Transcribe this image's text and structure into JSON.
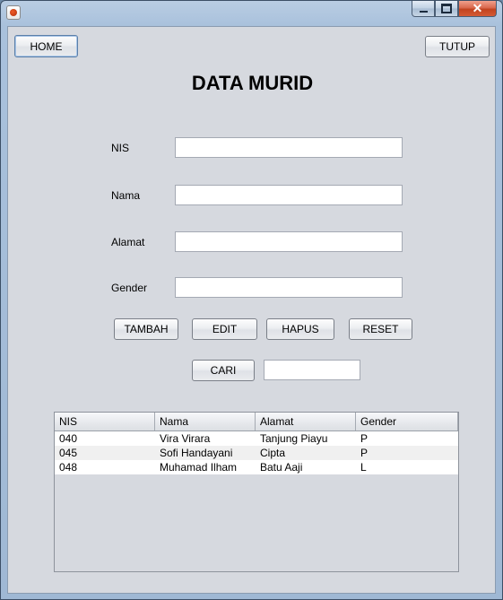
{
  "window": {
    "title": "",
    "caption_buttons": {
      "minimize": "minimize-icon",
      "maximize": "maximize-icon",
      "close": "close-icon"
    }
  },
  "toolbar": {
    "home_label": "HOME",
    "close_label": "TUTUP"
  },
  "page_title": "DATA MURID",
  "form": {
    "nis_label": "NIS",
    "nis_value": "",
    "nama_label": "Nama",
    "nama_value": "",
    "alamat_label": "Alamat",
    "alamat_value": "",
    "gender_label": "Gender",
    "gender_value": ""
  },
  "actions": {
    "add_label": "TAMBAH",
    "edit_label": "EDIT",
    "delete_label": "HAPUS",
    "reset_label": "RESET"
  },
  "search": {
    "button_label": "CARI",
    "value": ""
  },
  "table": {
    "columns": [
      "NIS",
      "Nama",
      "Alamat",
      "Gender"
    ],
    "rows": [
      [
        "040",
        "Vira Virara",
        "Tanjung Piayu",
        "P"
      ],
      [
        "045",
        "Sofi Handayani",
        "Cipta",
        "P"
      ],
      [
        "048",
        "Muhamad Ilham",
        "Batu Aaji",
        "L"
      ]
    ]
  }
}
